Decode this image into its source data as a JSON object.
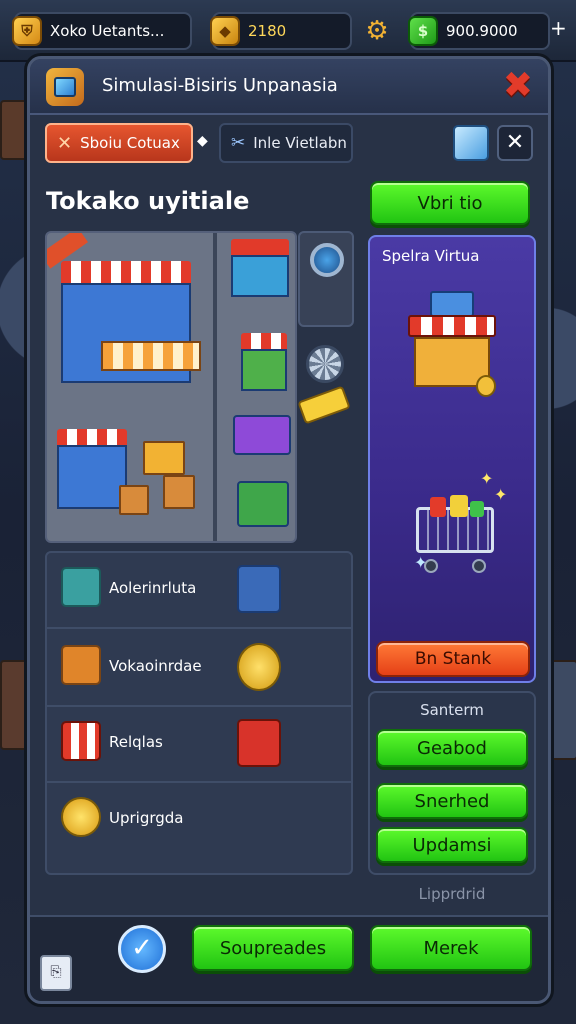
{
  "topbar": {
    "player_name": "Xoko Uetants...",
    "gold": "2180",
    "cash": "900.9000"
  },
  "window": {
    "title": "Simulasi-Bisiris Unpanasia"
  },
  "tabs": {
    "active_label": "Sboiu Cotuax",
    "separator": "◆",
    "second_label": "Inle Vietlabn"
  },
  "shop": {
    "title": "Tokako uyitiale",
    "top_button": "Vbri tio"
  },
  "promo": {
    "title": "Spelra Virtua",
    "button": "Bn Stank"
  },
  "list": {
    "items": [
      {
        "label": "Aolerinrluta"
      },
      {
        "label": "Vokaoinrdae"
      },
      {
        "label": "Relqlas"
      },
      {
        "label": "Uprigrgda"
      }
    ]
  },
  "system": {
    "title": "Santerm",
    "buttons": [
      "Geabod",
      "Snerhed",
      "Updamsi"
    ],
    "footer": "Lipprdrid"
  },
  "bottom": {
    "btn_left": "Soupreades",
    "btn_right": "Merek"
  },
  "colors": {
    "green": "#2bd118",
    "orange": "#e8491a",
    "panel": "#283246",
    "promo": "#3a2a8a"
  }
}
